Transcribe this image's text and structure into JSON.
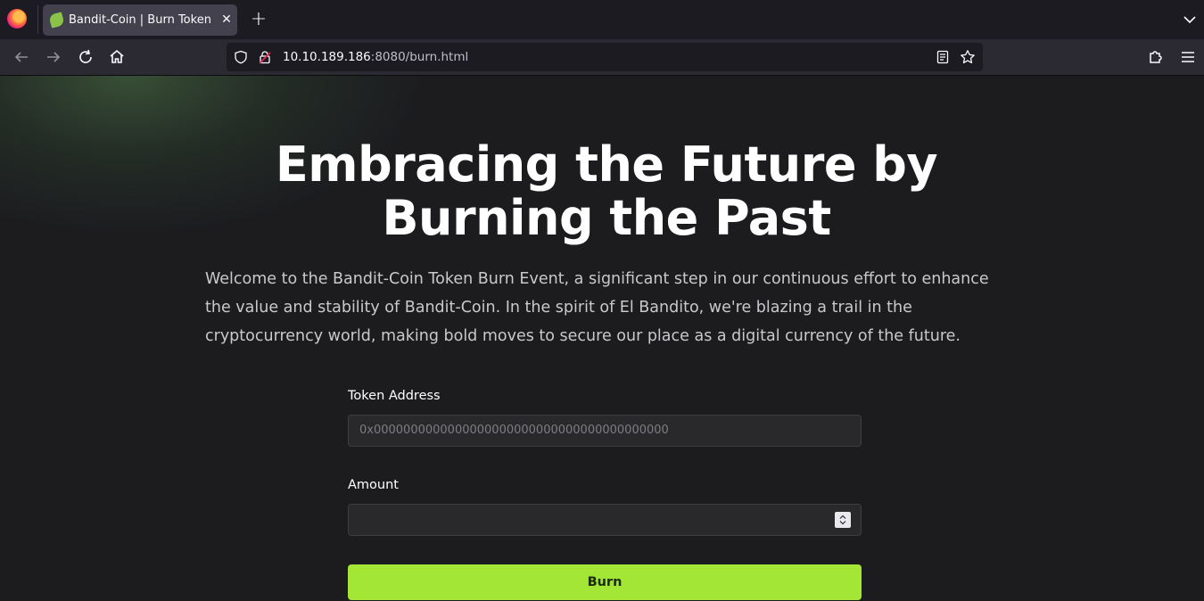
{
  "browser": {
    "tab_title": "Bandit-Coin | Burn Token",
    "tab_close": "✕",
    "new_tab": "+",
    "url_host": "10.10.189.186",
    "url_rest": ":8080/burn.html"
  },
  "hero": {
    "title_line1": "Embracing the Future by",
    "title_line2": "Burning the Past",
    "intro": "Welcome to the Bandit-Coin Token Burn Event, a significant step in our continuous effort to enhance the value and stability of Bandit-Coin. In the spirit of El Bandito, we're blazing a trail in the cryptocurrency world, making bold moves to secure our place as a digital currency of the future."
  },
  "form": {
    "token_label": "Token Address",
    "token_placeholder": "0x0000000000000000000000000000000000000000",
    "amount_label": "Amount",
    "amount_value": "",
    "submit_label": "Burn"
  },
  "colors": {
    "accent": "#a3e635",
    "page_bg": "#1c1c1f",
    "chrome_bg": "#2b2a33"
  }
}
